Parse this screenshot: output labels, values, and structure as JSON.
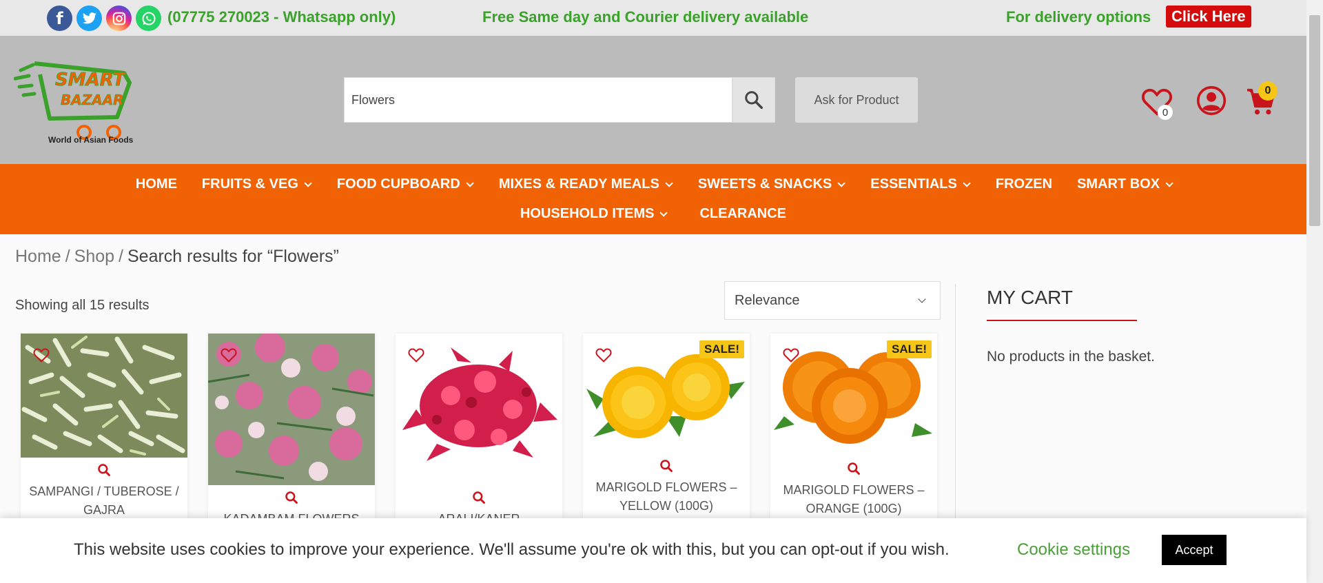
{
  "topbar": {
    "phone": "(07775 270023 - Whatsapp only)",
    "free_delivery": "Free Same day and Courier delivery available",
    "delivery_options": "For delivery options",
    "click_here": "Click Here",
    "social": [
      "facebook-icon",
      "twitter-icon",
      "instagram-icon",
      "whatsapp-icon"
    ]
  },
  "header": {
    "logo_tagline": "World of Asian Foods",
    "search_value": "Flowers",
    "ask_product": "Ask for Product",
    "wishlist_count": "0",
    "cart_count": "0"
  },
  "nav": {
    "row1": [
      {
        "label": "HOME",
        "dropdown": false
      },
      {
        "label": "FRUITS & VEG",
        "dropdown": true
      },
      {
        "label": "FOOD CUPBOARD",
        "dropdown": true
      },
      {
        "label": "MIXES & READY MEALS",
        "dropdown": true
      },
      {
        "label": "SWEETS & SNACKS",
        "dropdown": true
      },
      {
        "label": "ESSENTIALS",
        "dropdown": true
      },
      {
        "label": "FROZEN",
        "dropdown": false
      },
      {
        "label": "SMART BOX",
        "dropdown": true
      }
    ],
    "row2": [
      {
        "label": "HOUSEHOLD ITEMS",
        "dropdown": true
      },
      {
        "label": "CLEARANCE",
        "dropdown": false
      }
    ]
  },
  "breadcrumb": {
    "home": "Home",
    "sep1": "/",
    "shop": "Shop",
    "sep2": "/",
    "current": "Search results for “Flowers”"
  },
  "results": {
    "count_text": "Showing all 15 results",
    "sort_value": "Relevance"
  },
  "products": [
    {
      "title": "SAMPANGI / TUBEROSE / GAJRA",
      "sale": false
    },
    {
      "title": "KADAMBAM FLOWERS",
      "sale": false
    },
    {
      "title": "ARALI/KANER",
      "sale": false
    },
    {
      "title": "MARIGOLD FLOWERS – YELLOW (100G)",
      "sale": true
    },
    {
      "title": "MARIGOLD FLOWERS – ORANGE (100G)",
      "sale": true
    }
  ],
  "sale_label": "SALE!",
  "cart": {
    "title": "MY CART",
    "empty": "No products in the basket."
  },
  "cookie": {
    "text": "This website uses cookies to improve your experience. We'll assume you're ok with this, but you can opt-out if you wish.",
    "settings": "Cookie settings",
    "accept": "Accept"
  },
  "colors": {
    "accent_orange": "#f06204",
    "green": "#3aa12a",
    "red": "#d50b0b",
    "sale_yellow": "#f5c517"
  }
}
